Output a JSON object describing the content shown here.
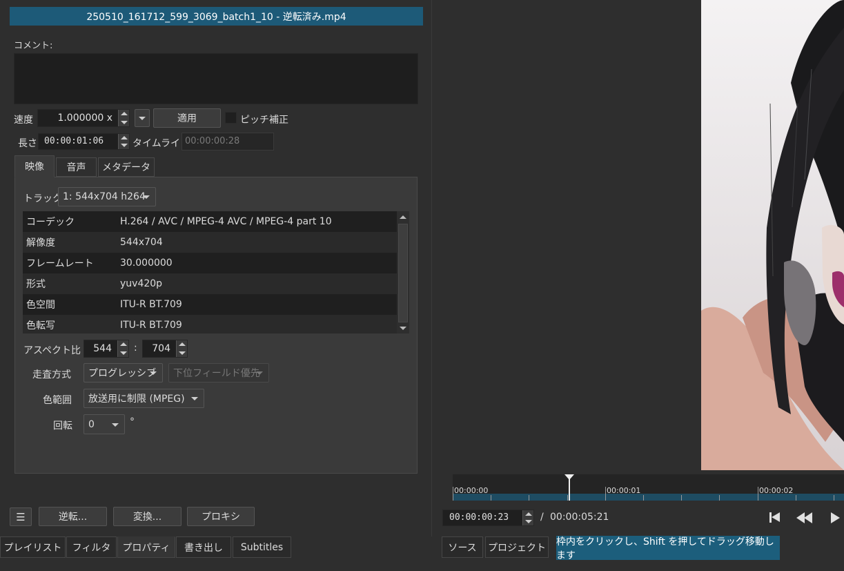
{
  "title": "250510_161712_599_3069_batch1_10 - 逆転済み.mp4",
  "comment_label": "コメント:",
  "comment_value": "",
  "speed": {
    "label": "速度",
    "value": "1.000000 x",
    "apply_label": "適用",
    "pitch_label": "ピッチ補正"
  },
  "duration": {
    "label": "長さ",
    "value": "00:00:01:06",
    "timeline_label": "タイムライン",
    "timeline_value": "00:00:00:28"
  },
  "tabs": [
    "映像",
    "音声",
    "メタデータ"
  ],
  "track": {
    "label": "トラック",
    "value": "1: 544x704 h264"
  },
  "info_rows": [
    {
      "key": "コーデック",
      "value": "H.264 / AVC / MPEG-4 AVC / MPEG-4 part 10"
    },
    {
      "key": "解像度",
      "value": "544x704"
    },
    {
      "key": "フレームレート",
      "value": "30.000000"
    },
    {
      "key": "形式",
      "value": "yuv420p"
    },
    {
      "key": "色空間",
      "value": "ITU-R BT.709"
    },
    {
      "key": "色転写",
      "value": "ITU-R BT.709"
    }
  ],
  "aspect": {
    "label": "アスペクト比",
    "w": "544",
    "sep": ":",
    "h": "704"
  },
  "scan": {
    "label": "走査方式",
    "value": "プログレッシブ",
    "field_value": "下位フィールド優先"
  },
  "color_range": {
    "label": "色範囲",
    "value": "放送用に制限 (MPEG)"
  },
  "rotation": {
    "label": "回転",
    "value": "0",
    "unit": "°"
  },
  "actions": {
    "menu": "☰",
    "reverse": "逆転...",
    "convert": "変換...",
    "proxy": "プロキシ"
  },
  "bottom_tabs_left": [
    "プレイリスト",
    "フィルタ",
    "プロパティ",
    "書き出し",
    "Subtitles"
  ],
  "bottom_tabs_right": [
    "ソース",
    "プロジェクト"
  ],
  "status_message": "枠内をクリックし、Shift を押してドラッグ移動します",
  "timeline": {
    "labels": [
      "00:00:00",
      "00:00:01",
      "00:00:02"
    ],
    "position": "00:00:00:23",
    "sep": "/",
    "total": "00:00:05:21"
  },
  "colors": {
    "accent": "#1d5a78",
    "status_bg": "#1c5e7c",
    "panel_bg": "#2e2e2e"
  }
}
